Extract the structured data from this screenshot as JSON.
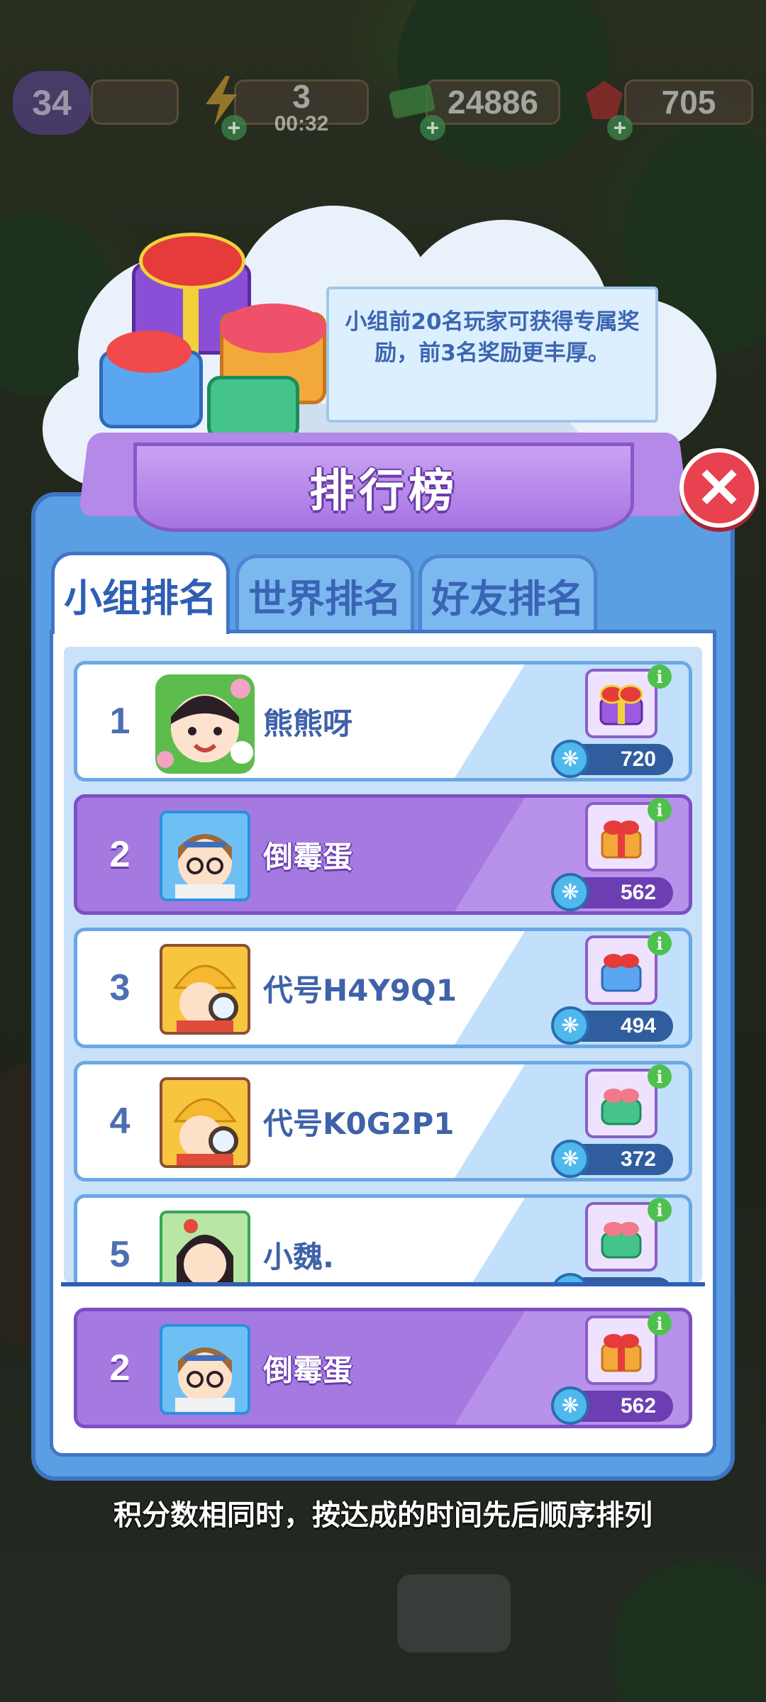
{
  "status_bar": {
    "level": "34",
    "energy_value": "3",
    "energy_timer": "00:32",
    "cash_value": "24886",
    "gem_value": "705",
    "icons": [
      "level-badge-icon",
      "lightning-icon",
      "cash-icon",
      "ruby-icon"
    ]
  },
  "tooltip": {
    "text": "小组前20名玩家可获得专属奖励，前3名奖励更丰厚。"
  },
  "panel": {
    "title": "排行榜",
    "close_icon": "close-icon"
  },
  "tabs": [
    {
      "label": "小组排名",
      "active": true
    },
    {
      "label": "世界排名",
      "active": false
    },
    {
      "label": "好友排名",
      "active": false
    }
  ],
  "leaderboard": [
    {
      "rank": "1",
      "name": "熊熊呀",
      "score": "720",
      "is_me": false,
      "avatar": "flower-frame-avatar",
      "reward": "purple-gift-icon"
    },
    {
      "rank": "2",
      "name": "倒霉蛋",
      "score": "562",
      "is_me": true,
      "avatar": "glasses-girl-avatar",
      "reward": "orange-gift-icon"
    },
    {
      "rank": "3",
      "name": "代号H4Y9Q1",
      "score": "494",
      "is_me": false,
      "avatar": "detective-avatar",
      "reward": "blue-gift-icon"
    },
    {
      "rank": "4",
      "name": "代号K0G2P1",
      "score": "372",
      "is_me": false,
      "avatar": "detective-avatar",
      "reward": "green-gift-icon"
    },
    {
      "rank": "5",
      "name": "小魏.",
      "score": "",
      "is_me": false,
      "avatar": "black-hair-girl-avatar",
      "reward": "green-gift-icon"
    }
  ],
  "my_rank": {
    "rank": "2",
    "name": "倒霉蛋",
    "score": "562"
  },
  "footer_note": "积分数相同时，按达成的时间先后顺序排列",
  "colors": {
    "panel_blue": "#5a9ee3",
    "me_row_purple": "#a57ae0",
    "close_red": "#e8414f",
    "score_pill": "#2f5d9e"
  }
}
